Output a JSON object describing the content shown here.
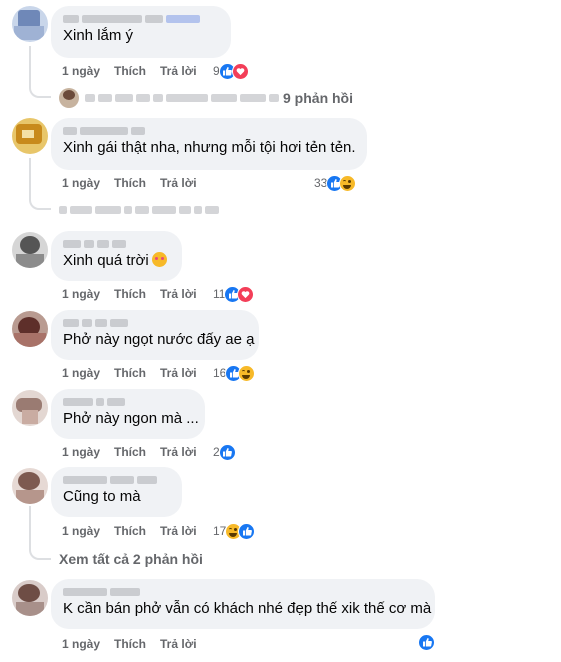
{
  "actions": {
    "time": "1 ngày",
    "like": "Thích",
    "reply": "Trả lời"
  },
  "comments": [
    {
      "text": "Xinh lắm ý",
      "reaction_count": "9",
      "reactions": [
        "like-icon",
        "love-icon"
      ]
    },
    {
      "text": "Xinh gái thật nha, nhưng mỗi tội hơi tẻn tẻn.",
      "reaction_count": "33",
      "reactions": [
        "like-icon",
        "haha-icon"
      ]
    },
    {
      "text": "Xinh quá trời",
      "emoji": "smiling-face-with-hearts",
      "reaction_count": "11",
      "reactions": [
        "like-icon",
        "love-icon"
      ]
    },
    {
      "text": "Phở này ngọt nước đấy ae ạ",
      "reaction_count": "16",
      "reactions": [
        "like-icon",
        "haha-icon"
      ]
    },
    {
      "text": "Phở này ngon mà ...",
      "reaction_count": "2",
      "reactions": [
        "like-icon"
      ]
    },
    {
      "text": "Cũng to mà",
      "reaction_count": "17",
      "reactions": [
        "haha-icon",
        "like-icon"
      ]
    },
    {
      "text": "K cần bán phở vẫn có khách nhé đẹp thế xik thế cơ mà",
      "reaction_count": "",
      "reactions": [
        "like-icon"
      ]
    }
  ],
  "replies_summary": {
    "count_label": "9 phản hồi"
  },
  "view_all_replies": "Xem tất cả 2 phản hồi",
  "colors": {
    "bubble": "#f0f2f5",
    "meta_text": "#65676b",
    "like": "#1877f2",
    "love": "#f33e58",
    "haha": "#f7b928",
    "thread_line": "#dddfe2"
  }
}
